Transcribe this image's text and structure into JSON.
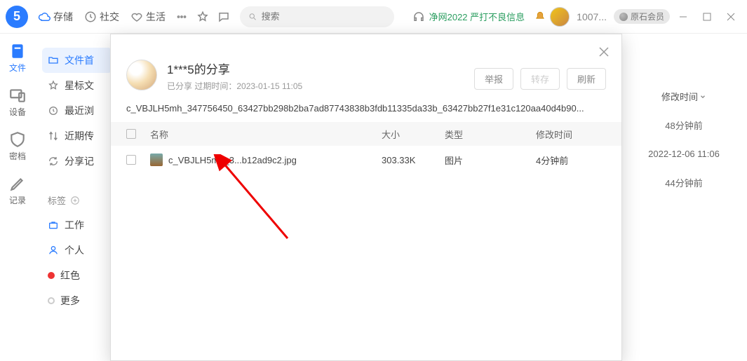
{
  "topbar": {
    "logo_text": "5",
    "items": [
      {
        "label": "存储",
        "icon": "cloud"
      },
      {
        "label": "社交",
        "icon": "clock"
      },
      {
        "label": "生活",
        "icon": "heart"
      }
    ],
    "search_placeholder": "搜索",
    "net_label": "净网2022 严打不良信息",
    "user_id": "1007...",
    "member_label": "原石会员"
  },
  "leftrail": [
    {
      "label": "文件",
      "active": true
    },
    {
      "label": "设备",
      "active": false
    },
    {
      "label": "密档",
      "active": false
    },
    {
      "label": "记录",
      "active": false
    }
  ],
  "sidebar": {
    "items": [
      {
        "label": "文件首",
        "icon": "folder",
        "active": true
      },
      {
        "label": "星标文",
        "icon": "star"
      },
      {
        "label": "最近浏",
        "icon": "clock"
      },
      {
        "label": "近期传",
        "icon": "transfer"
      },
      {
        "label": "分享记",
        "icon": "refresh"
      }
    ],
    "tags_header": "标签",
    "tags": [
      {
        "label": "工作",
        "color": "#2b7cff",
        "shape": "square"
      },
      {
        "label": "个人",
        "color": "#2b7cff",
        "shape": "circle-outline"
      },
      {
        "label": "红色",
        "color": "#e33",
        "shape": "circle"
      },
      {
        "label": "更多",
        "color": "#ccc",
        "shape": "circle-outline"
      }
    ]
  },
  "rightcol": {
    "header": "修改时间",
    "rows": [
      "48分钟前",
      "2022-12-06 11:06",
      "44分钟前"
    ]
  },
  "modal": {
    "title": "1***5的分享",
    "subtitle_prefix": "已分享  过期时间：",
    "subtitle_time": "2023-01-15 11:05",
    "actions": {
      "report": "举报",
      "save": "转存",
      "refresh": "刷新"
    },
    "path": "c_VBJLH5mh_347756450_63427bb298b2ba7ad87743838b3fdb11335da33b_63427bb27f1e31c120aa40d4b90...",
    "columns": {
      "name": "名称",
      "size": "大小",
      "type": "类型",
      "time": "修改时间"
    },
    "rows": [
      {
        "name": "c_VBJLH5mh_3...b12ad9c2.jpg",
        "size": "303.33K",
        "type": "图片",
        "time": "4分钟前"
      }
    ]
  }
}
